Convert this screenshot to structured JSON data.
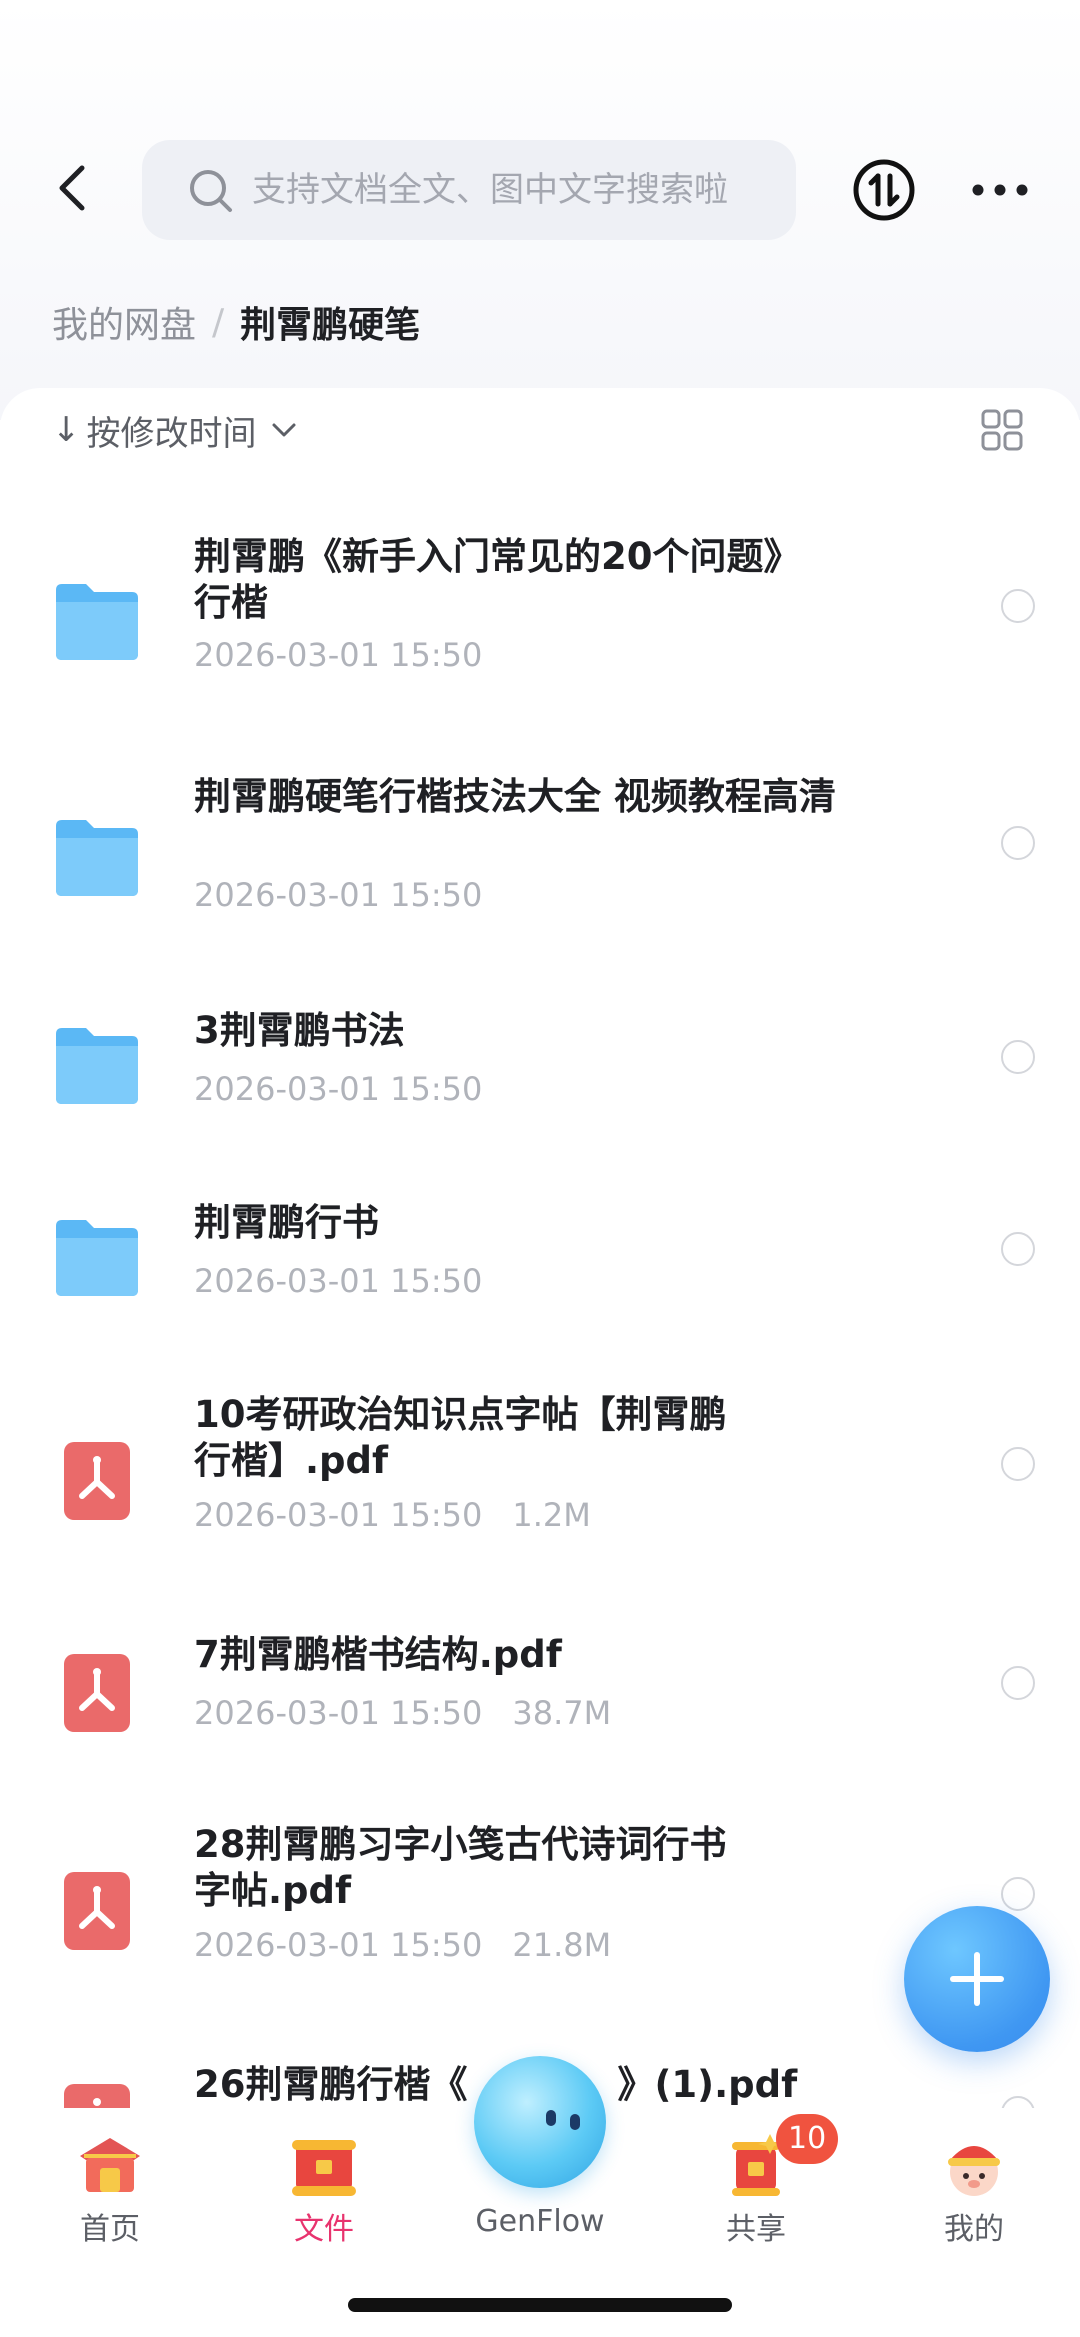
{
  "header": {
    "search_placeholder": "支持文档全文、图中文字搜索啦"
  },
  "breadcrumb": {
    "root": "我的网盘",
    "separator": "/",
    "current": "荆霄鹏硬笔"
  },
  "sort": {
    "arrow": "↓",
    "label": "按修改时间"
  },
  "files": [
    {
      "type": "folder",
      "name_line1": "荆霄鹏《新手入门常见的20个问题》",
      "name_line2": "行楷",
      "date": "2026-03-01 15:50",
      "size": ""
    },
    {
      "type": "folder",
      "name_line1": "荆霄鹏硬笔行楷技法大全 视频教程高清",
      "name_line2": "",
      "date": "2026-03-01 15:50",
      "size": ""
    },
    {
      "type": "folder",
      "name_line1": "3荆霄鹏书法",
      "name_line2": "",
      "date": "2026-03-01 15:50",
      "size": ""
    },
    {
      "type": "folder",
      "name_line1": "荆霄鹏行书",
      "name_line2": "",
      "date": "2026-03-01 15:50",
      "size": ""
    },
    {
      "type": "pdf",
      "name_line1": "10考研政治知识点字帖【荆霄鹏",
      "name_line2": "行楷】.pdf",
      "date": "2026-03-01 15:50",
      "size": "1.2M"
    },
    {
      "type": "pdf",
      "name_line1": "7荆霄鹏楷书结构.pdf",
      "name_line2": "",
      "date": "2026-03-01 15:50",
      "size": "38.7M"
    },
    {
      "type": "pdf",
      "name_line1": "28荆霄鹏习字小笺古代诗词行书",
      "name_line2": "字帖.pdf",
      "date": "2026-03-01 15:50",
      "size": "21.8M"
    },
    {
      "type": "pdf",
      "name_line1": "26荆霄鹏行楷《",
      "name_line2": "",
      "date": "",
      "size": ""
    }
  ],
  "last_file_suffix": "》(1).pdf",
  "nav": {
    "home": "首页",
    "files": "文件",
    "genflow": "GenFlow",
    "share": "共享",
    "me": "我的",
    "share_badge": "10"
  },
  "colors": {
    "accent_pink": "#e8336e",
    "folder_blue": "#5bb8f5",
    "pdf_red": "#ea6a6a",
    "fab_blue": "#3f97f2",
    "badge_red": "#f0533f"
  }
}
